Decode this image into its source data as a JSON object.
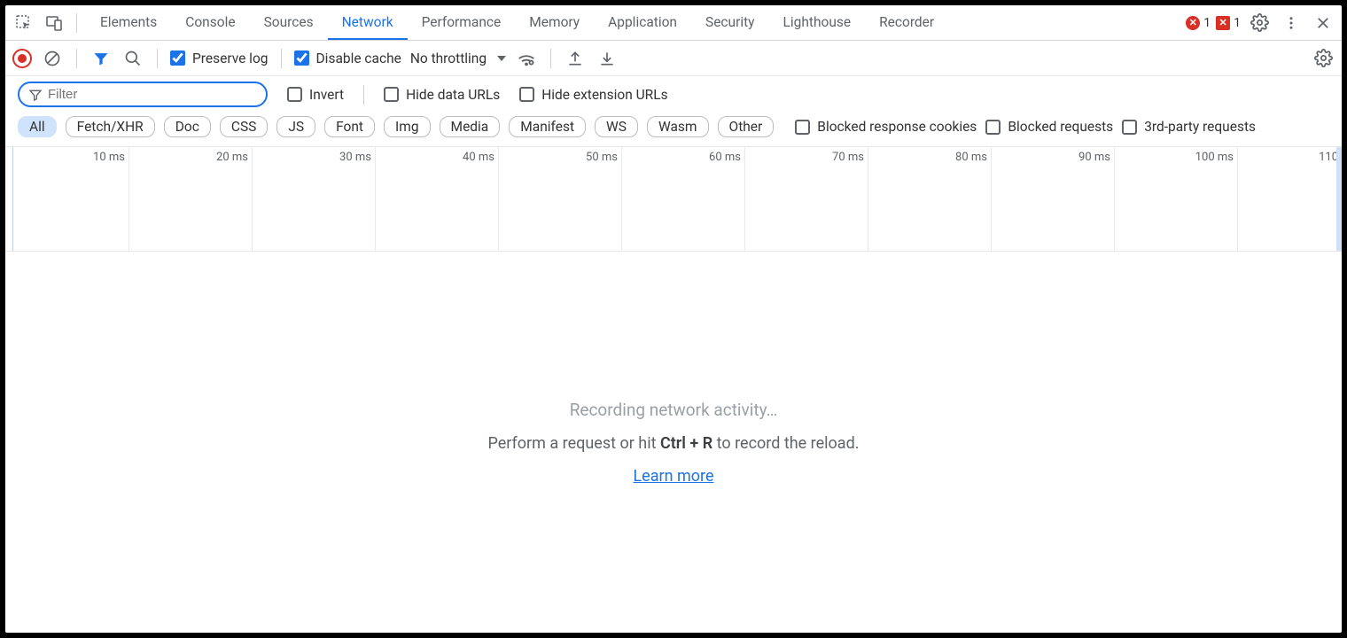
{
  "tabs": {
    "items": [
      "Elements",
      "Console",
      "Sources",
      "Network",
      "Performance",
      "Memory",
      "Application",
      "Security",
      "Lighthouse",
      "Recorder"
    ],
    "active": "Network"
  },
  "errors_count": "1",
  "issues_count": "1",
  "toolbar": {
    "preserve_log": "Preserve log",
    "disable_cache": "Disable cache",
    "throttling": "No throttling"
  },
  "filter": {
    "placeholder": "Filter",
    "invert": "Invert",
    "hide_data_urls": "Hide data URLs",
    "hide_ext_urls": "Hide extension URLs"
  },
  "chips": [
    "All",
    "Fetch/XHR",
    "Doc",
    "CSS",
    "JS",
    "Font",
    "Img",
    "Media",
    "Manifest",
    "WS",
    "Wasm",
    "Other"
  ],
  "chip_active": "All",
  "extra_chk": {
    "blocked_cookies": "Blocked response cookies",
    "blocked_requests": "Blocked requests",
    "third_party": "3rd-party requests"
  },
  "timeline": {
    "ticks": [
      "10 ms",
      "20 ms",
      "30 ms",
      "40 ms",
      "50 ms",
      "60 ms",
      "70 ms",
      "80 ms",
      "90 ms",
      "100 ms",
      "110"
    ]
  },
  "empty": {
    "line1": "Recording network activity…",
    "line2_pre": "Perform a request or hit ",
    "line2_kbd": "Ctrl + R",
    "line2_post": " to record the reload.",
    "link": "Learn more"
  }
}
